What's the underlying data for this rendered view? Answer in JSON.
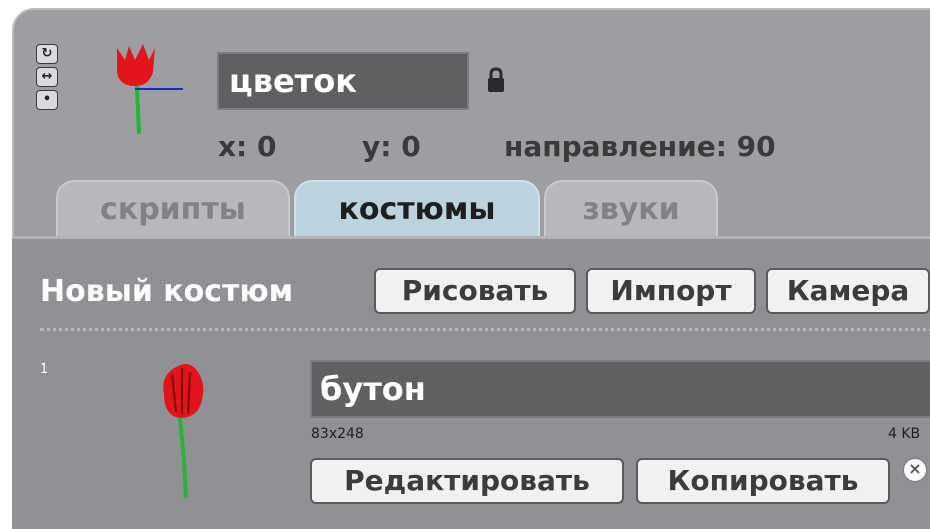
{
  "sprite": {
    "name": "цветок",
    "x_label": "x: 0",
    "y_label": "y: 0",
    "direction_label": "направление: 90"
  },
  "rotation_buttons": [
    {
      "icon": "rotate-icon",
      "glyph": "↻"
    },
    {
      "icon": "left-right-icon",
      "glyph": "↔"
    },
    {
      "icon": "no-rotate-icon",
      "glyph": "•"
    }
  ],
  "tabs": [
    {
      "label": "скрипты",
      "active": false
    },
    {
      "label": "костюмы",
      "active": true
    },
    {
      "label": "звуки",
      "active": false
    }
  ],
  "costumes_panel": {
    "new_costume_label": "Новый костюм",
    "paint_label": "Рисовать",
    "import_label": "Импорт",
    "camera_label": "Камера"
  },
  "costume": {
    "number": "1",
    "name": "бутон",
    "size": "83x248",
    "file_size": "4 KB",
    "edit_label": "Редактировать",
    "copy_label": "Копировать"
  },
  "colors": {
    "panel_bg": "#9c9ea2",
    "active_tab": "#bcd2de",
    "text_field": "#5f6062"
  }
}
